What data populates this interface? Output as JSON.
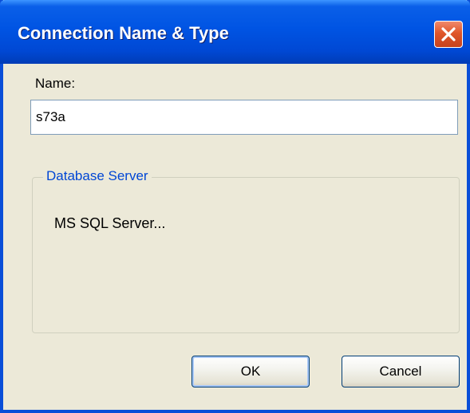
{
  "window": {
    "title": "Connection Name & Type",
    "close_icon": "close-icon"
  },
  "form": {
    "name_label": "Name:",
    "name_value": "s73a"
  },
  "database_group": {
    "title": "Database Server",
    "server_label": "MS SQL Server..."
  },
  "buttons": {
    "ok_label": "OK",
    "cancel_label": "Cancel"
  },
  "colors": {
    "titlebar": "#0054e3",
    "dialog_bg": "#ece9d8",
    "group_title": "#0046d5",
    "close_button": "#e0562a"
  }
}
